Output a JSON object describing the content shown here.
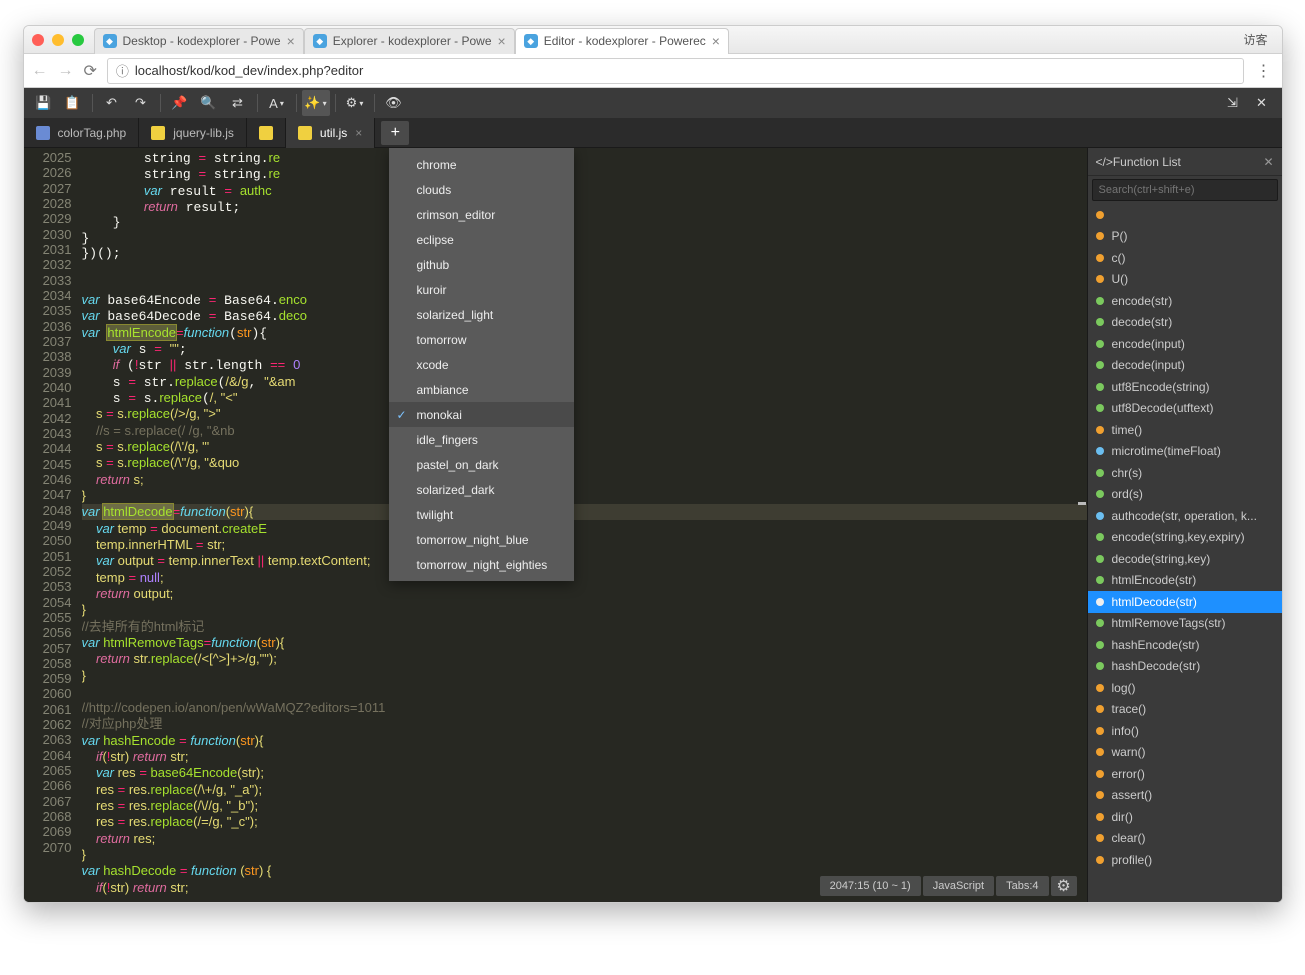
{
  "browser": {
    "guest": "访客",
    "tabs": [
      {
        "label": "Desktop - kodexplorer - Powe",
        "active": false
      },
      {
        "label": "Explorer - kodexplorer - Powe",
        "active": false
      },
      {
        "label": "Editor - kodexplorer - Powerec",
        "active": true
      }
    ],
    "url_prefix": "ⓘ",
    "url": "localhost/kod/kod_dev/index.php?editor"
  },
  "toolbar_icons": [
    "save",
    "copy",
    "",
    "undo",
    "redo",
    "",
    "pin",
    "search",
    "shuffle",
    "",
    "font",
    "",
    "magic",
    "",
    "gear",
    "",
    "eye"
  ],
  "toolbar_right": [
    "compress",
    "close"
  ],
  "file_tabs": [
    {
      "label": "colorTag.php",
      "icon": "php"
    },
    {
      "label": "jquery-lib.js",
      "icon": "js"
    },
    {
      "label": "",
      "icon": "js",
      "hidden_label": true
    },
    {
      "label": "util.js",
      "icon": "",
      "closable": true
    }
  ],
  "themes": [
    "chrome",
    "clouds",
    "crimson_editor",
    "eclipse",
    "github",
    "kuroir",
    "solarized_light",
    "tomorrow",
    "xcode",
    "ambiance",
    "monokai",
    "idle_fingers",
    "pastel_on_dark",
    "solarized_dark",
    "twilight",
    "tomorrow_night_blue",
    "tomorrow_night_eighties"
  ],
  "theme_selected": "monokai",
  "gutter_start": 2025,
  "gutter_end": 2070,
  "fold_lines": [
    2036,
    2047,
    2055,
    2061,
    2069
  ],
  "code_lines": [
    "        string <op>=</op> string.<fn>re</fn>",
    "        string <op>=</op> string.<fn>re</fn>",
    "        <kw2>var</kw2> result <op>=</op> <fn>authc</fn>",
    "        <kw>return</kw> result;",
    "    }",
    "}",
    "})();",
    "",
    "",
    "<kw2>var</kw2> base64Encode <op>=</op> Base64.<fn>enco</fn>",
    "<kw2>var</kw2> base64Decode <op>=</op> Base64.<fn>deco</fn>",
    "<kw2>var</kw2> <fn><hl>htmlEncode</hl></fn><op>=</op><kw2>function</kw2>(<pr>str</pr>){",
    "    <kw2>var</kw2> s <op>=</op> <str>\"\"</str>;",
    "    <kw>if</kw> (<op>!</op>str <op>||</op> str.length <op>==</op> <num>0</num>",
    "    s <op>=</op> str.<fn>replace</fn>(<str>/&/g</str>, <str>\"&am</str>",
    "    s <op>=</op> s.<fn>replace</fn>(<str>/</g</str>, <str>\"&lt;\"</str>",
    "    s <op>=</op> s.<fn>replace</fn>(<str>/>/g</str>, <str>\"&gt;\"</str>",
    "    <cm>//s = s.replace(/ /g, \"&nb</cm>",
    "    s <op>=</op> s.<fn>replace</fn>(<str>/\\'/g</str>, <str>\"&#39;</str>",
    "    s <op>=</op> s.<fn>replace</fn>(<str>/\\\"/g</str>, <str>\"&quo</str>",
    "    <kw>return</kw> s;",
    "}",
    "<cur-line><kw2>var</kw2> <fn><hl>htmlDecode</hl></fn><op>=</op><kw2>function</kw2>(<pr>str</pr>){</cur-line>",
    "    <kw2>var</kw2> temp <op>=</op> document.<fn>createE</fn>",
    "    temp.innerHTML <op>=</op> str;",
    "    <kw2>var</kw2> output <op>=</op> temp.innerText <op>||</op> temp.textContent;",
    "    temp <op>=</op> <num>null</num>;",
    "    <kw>return</kw> output;",
    "}",
    "<cm>//去掉所有的html标记</cm>",
    "<kw2>var</kw2> <fn>htmlRemoveTags</fn><op>=</op><kw2>function</kw2>(<pr>str</pr>){",
    "    <kw>return</kw> str.<fn>replace</fn>(<str>/<[^>]+>/g</str>,<str>\"\"</str>);",
    "}",
    "",
    "<cm>//http://codepen.io/anon/pen/wWaMQZ?editors=1011</cm>",
    "<cm>//对应php处理</cm>",
    "<kw2>var</kw2> <fn>hashEncode</fn> <op>=</op> <kw2>function</kw2>(<pr>str</pr>){",
    "    <kw>if</kw>(<op>!</op>str) <kw>return</kw> str;",
    "    <kw2>var</kw2> res <op>=</op> <fn>base64Encode</fn>(str);",
    "    res <op>=</op> res.<fn>replace</fn>(<str>/\\+/g</str>, <str>\"_a\"</str>);",
    "    res <op>=</op> res.<fn>replace</fn>(<str>/\\//g</str>, <str>\"_b\"</str>);",
    "    res <op>=</op> res.<fn>replace</fn>(<str>/=/g</str>, <str>\"_c\"</str>);",
    "    <kw>return</kw> res;",
    "}",
    "<kw2>var</kw2> <fn>hashDecode</fn> <op>=</op> <kw2>function</kw2> (<pr>str</pr>) {",
    "    <kw>if</kw>(<op>!</op>str) <kw>return</kw> str;"
  ],
  "functions": [
    {
      "c": "o",
      "n": ""
    },
    {
      "c": "o",
      "n": "P()"
    },
    {
      "c": "o",
      "n": "c()"
    },
    {
      "c": "o",
      "n": "U()"
    },
    {
      "c": "g",
      "n": "encode(str)"
    },
    {
      "c": "g",
      "n": "decode(str)"
    },
    {
      "c": "g",
      "n": "encode(input)"
    },
    {
      "c": "g",
      "n": "decode(input)"
    },
    {
      "c": "g",
      "n": "utf8Encode(string)"
    },
    {
      "c": "g",
      "n": "utf8Decode(utftext)"
    },
    {
      "c": "o",
      "n": "time()"
    },
    {
      "c": "b",
      "n": "microtime(timeFloat)"
    },
    {
      "c": "g",
      "n": "chr(s)"
    },
    {
      "c": "g",
      "n": "ord(s)"
    },
    {
      "c": "b",
      "n": "authcode(str, operation, k..."
    },
    {
      "c": "g",
      "n": "encode(string,key,expiry)"
    },
    {
      "c": "g",
      "n": "decode(string,key)"
    },
    {
      "c": "g",
      "n": "htmlEncode(str)"
    },
    {
      "c": "w",
      "n": "htmlDecode(str)",
      "act": true
    },
    {
      "c": "g",
      "n": "htmlRemoveTags(str)"
    },
    {
      "c": "g",
      "n": "hashEncode(str)"
    },
    {
      "c": "g",
      "n": "hashDecode(str)"
    },
    {
      "c": "o",
      "n": "log()"
    },
    {
      "c": "o",
      "n": "trace()"
    },
    {
      "c": "o",
      "n": "info()"
    },
    {
      "c": "o",
      "n": "warn()"
    },
    {
      "c": "o",
      "n": "error()"
    },
    {
      "c": "o",
      "n": "assert()"
    },
    {
      "c": "o",
      "n": "dir()"
    },
    {
      "c": "o",
      "n": "clear()"
    },
    {
      "c": "o",
      "n": "profile()"
    }
  ],
  "side": {
    "title": "</>Function List",
    "placeholder": "Search(ctrl+shift+e)"
  },
  "status": {
    "pos": "2047:15 (10 ~ 1)",
    "lang": "JavaScript",
    "tabs": "Tabs:4"
  }
}
